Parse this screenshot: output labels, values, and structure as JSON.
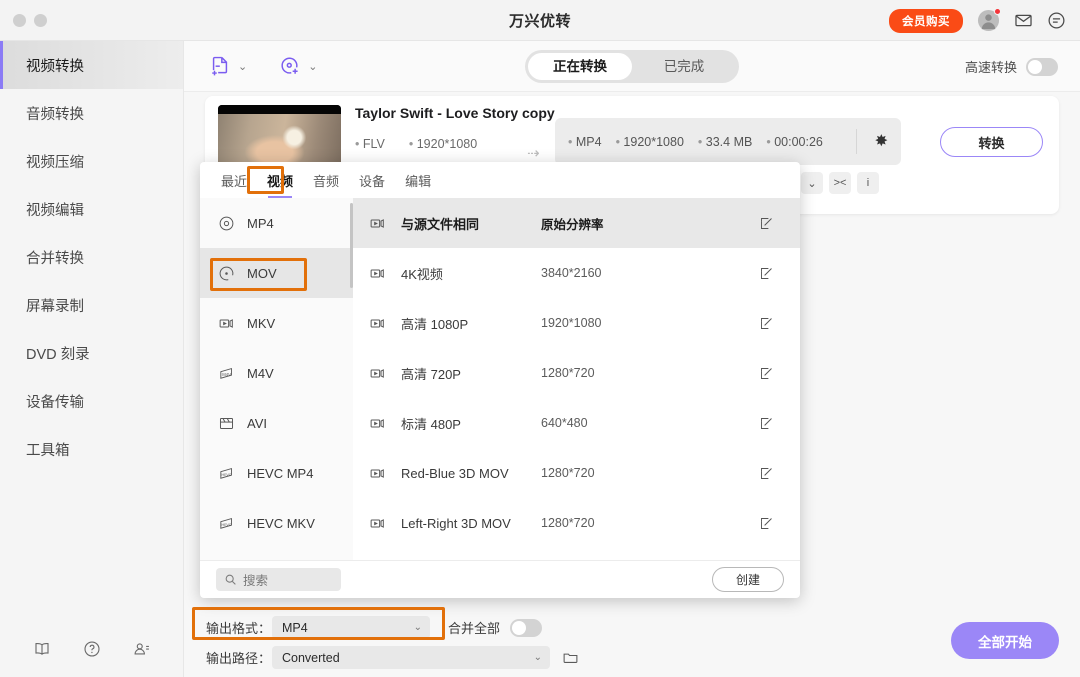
{
  "window": {
    "title": "万兴优转"
  },
  "titlebar": {
    "vip_label": "会员购买",
    "icons": [
      "avatar-icon",
      "mail-icon",
      "feedback-icon"
    ]
  },
  "sidebar": {
    "items": [
      {
        "label": "视频转换",
        "active": true
      },
      {
        "label": "音频转换",
        "active": false
      },
      {
        "label": "视频压缩",
        "active": false
      },
      {
        "label": "视频编辑",
        "active": false
      },
      {
        "label": "合并转换",
        "active": false
      },
      {
        "label": "屏幕录制",
        "active": false
      },
      {
        "label": "DVD 刻录",
        "active": false
      },
      {
        "label": "设备传输",
        "active": false
      },
      {
        "label": "工具箱",
        "active": false
      }
    ],
    "bottom_icons": [
      "book-icon",
      "help-icon",
      "contact-icon"
    ]
  },
  "toolbar": {
    "add_file_icon": "add-file-icon",
    "add_disc_icon": "add-disc-icon",
    "tabs": [
      {
        "label": "正在转换",
        "active": true
      },
      {
        "label": "已完成",
        "active": false
      }
    ],
    "highspeed_label": "高速转换",
    "highspeed_on": false
  },
  "file_card": {
    "title": "Taylor Swift - Love Story copy",
    "source_meta": [
      "FLV",
      "1920*1080"
    ],
    "target_meta": [
      "MP4",
      "1920*1080",
      "33.4 MB",
      "00:00:26"
    ],
    "gear_icon": "gear-icon",
    "convert_label": "转换",
    "sub_buttons": [
      "chevron-down-icon",
      "crop-icon",
      "info-icon"
    ]
  },
  "preset_panel": {
    "tabs": [
      {
        "label": "最近",
        "active": false
      },
      {
        "label": "视频",
        "active": true
      },
      {
        "label": "音频",
        "active": false
      },
      {
        "label": "设备",
        "active": false
      },
      {
        "label": "编辑",
        "active": false
      }
    ],
    "formats": [
      {
        "label": "MP4",
        "icon": "disc-icon",
        "selected": false
      },
      {
        "label": "MOV",
        "icon": "disc-dot-icon",
        "selected": true
      },
      {
        "label": "MKV",
        "icon": "video-icon",
        "selected": false
      },
      {
        "label": "M4V",
        "icon": "m4v-icon",
        "selected": false
      },
      {
        "label": "AVI",
        "icon": "clapper-icon",
        "selected": false
      },
      {
        "label": "HEVC MP4",
        "icon": "hevc-icon",
        "selected": false
      },
      {
        "label": "HEVC MKV",
        "icon": "hevc-icon",
        "selected": false
      }
    ],
    "presets": [
      {
        "name": "与源文件相同",
        "resolution": "原始分辨率",
        "selected": true
      },
      {
        "name": "4K视频",
        "resolution": "3840*2160",
        "selected": false
      },
      {
        "name": "高清 1080P",
        "resolution": "1920*1080",
        "selected": false
      },
      {
        "name": "高清 720P",
        "resolution": "1280*720",
        "selected": false
      },
      {
        "name": "标清 480P",
        "resolution": "640*480",
        "selected": false
      },
      {
        "name": "Red-Blue 3D MOV",
        "resolution": "1280*720",
        "selected": false
      },
      {
        "name": "Left-Right 3D MOV",
        "resolution": "1280*720",
        "selected": false
      }
    ],
    "search_placeholder": "搜索",
    "create_label": "创建"
  },
  "output_bar": {
    "format_label": "输出格式：",
    "format_value": "MP4",
    "merge_label": "合并全部",
    "merge_on": false,
    "path_label": "输出路径：",
    "path_value": "Converted",
    "folder_icon": "folder-icon",
    "start_all_label": "全部开始"
  },
  "colors": {
    "accent_purple": "#9b87f7",
    "vip_orange": "#fa4b16",
    "highlight_orange": "#e2700a",
    "badge_red": "#f5353a"
  }
}
